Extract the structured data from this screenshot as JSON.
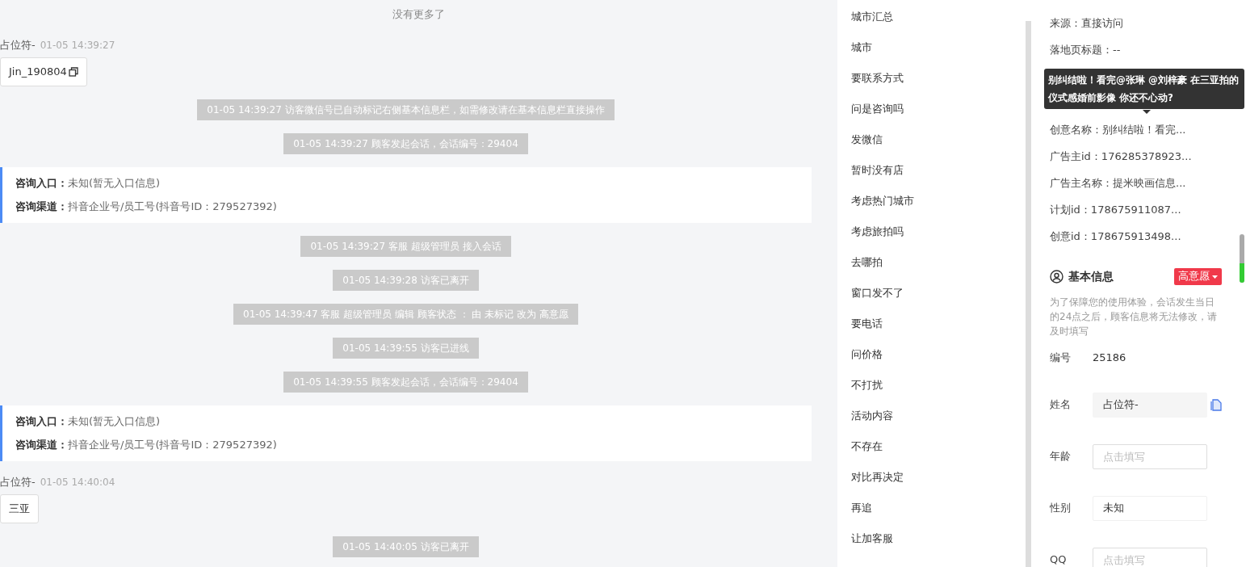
{
  "chat": {
    "top_note": "没有更多了",
    "messages": [
      {
        "kind": "visitor",
        "name": "占位符-",
        "time": "01-05 14:39:27",
        "text": "Jin_190804",
        "copyable": true
      },
      {
        "kind": "notice",
        "text": "01-05 14:39:27 访客微信号已自动标记右侧基本信息栏，如需修改请在基本信息栏直接操作"
      },
      {
        "kind": "notice",
        "text": "01-05 14:39:27 顾客发起会话，会话编号：29404"
      },
      {
        "kind": "info",
        "lines": [
          "**咨询入口：**未知(暂无入口信息)",
          "**咨询渠道：**抖音企业号/员工号(抖音号ID：279527392)"
        ]
      },
      {
        "kind": "notice",
        "text": "01-05 14:39:27 客服 超级管理员 接入会话"
      },
      {
        "kind": "notice",
        "text": "01-05 14:39:28 访客已离开"
      },
      {
        "kind": "notice",
        "text": "01-05 14:39:47 客服 超级管理员 编辑 顾客状态 ： 由 未标记 改为 高意愿"
      },
      {
        "kind": "notice",
        "text": "01-05 14:39:55 访客已进线"
      },
      {
        "kind": "notice",
        "text": "01-05 14:39:55 顾客发起会话，会话编号：29404"
      },
      {
        "kind": "info",
        "lines": [
          "**咨询入口：**未知(暂无入口信息)",
          "**咨询渠道：**抖音企业号/员工号(抖音号ID：279527392)"
        ]
      },
      {
        "kind": "visitor",
        "name": "占位符-",
        "time": "01-05 14:40:04",
        "text": "三亚",
        "copyable": false
      },
      {
        "kind": "notice",
        "text": "01-05 14:40:05 访客已离开"
      }
    ]
  },
  "quick_replies": [
    "城市汇总",
    "城市",
    "要联系方式",
    "问是咨询吗",
    "发微信",
    "暂时没有店",
    "考虑热门城市",
    "考虑旅拍吗",
    "去哪拍",
    "窗口发不了",
    "要电话",
    "问价格",
    "不打扰",
    "活动内容",
    "不存在",
    "对比再决定",
    "再追",
    "让加客服"
  ],
  "ad_info": {
    "rows_before": [
      "来源：直接访问",
      "落地页标题：--"
    ],
    "tooltip": "别纠结啦！看完@张琳 @刘梓豪 在三亚拍的仪式感婚前影像 你还不心动?",
    "rows_after": [
      "创意名称：别纠结啦！看完...",
      "广告主id：176285378923...",
      "广告主名称：提米映画信息...",
      "计划id：178675911087...",
      "创意id：178675913498..."
    ]
  },
  "basic_info": {
    "title": "基本信息",
    "status": "高意愿",
    "note": "为了保障您的使用体验，会话发生当日的24点之后，顾客信息将无法修改，请及时填写",
    "fields": [
      {
        "kind": "text",
        "label": "编号",
        "value": "25186"
      },
      {
        "kind": "readonly",
        "label": "姓名",
        "value": "占位符-"
      },
      {
        "kind": "input",
        "label": "年龄",
        "placeholder": "点击填写"
      },
      {
        "kind": "select",
        "label": "性别",
        "value": "未知"
      },
      {
        "kind": "input",
        "label": "QQ",
        "placeholder": "点击填写"
      }
    ]
  }
}
